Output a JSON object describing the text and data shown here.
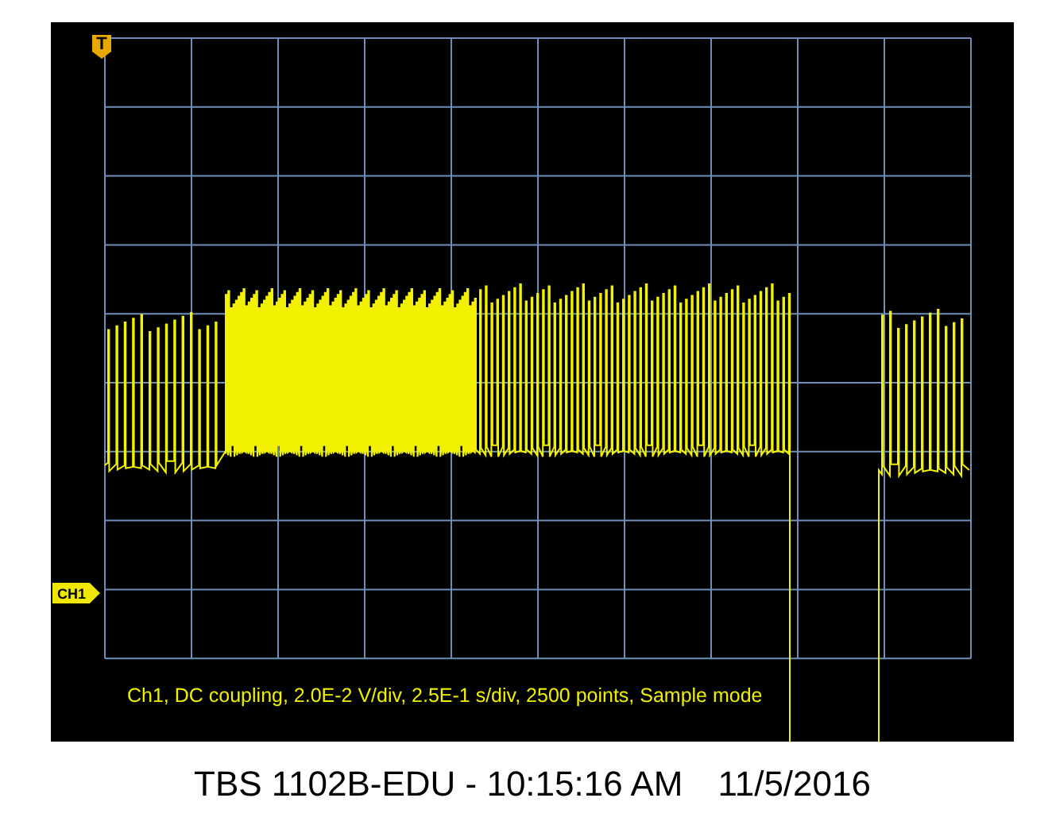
{
  "trigger_marker": {
    "label": "T"
  },
  "channel_marker": {
    "label": "CH1"
  },
  "status_line": "Ch1, DC coupling, 2.0E-2 V/div, 2.5E-1 s/div, 2500 points, Sample mode",
  "caption": {
    "model_time": "TBS 1102B-EDU - 10:15:16 AM",
    "date": "11/5/2016"
  }
}
